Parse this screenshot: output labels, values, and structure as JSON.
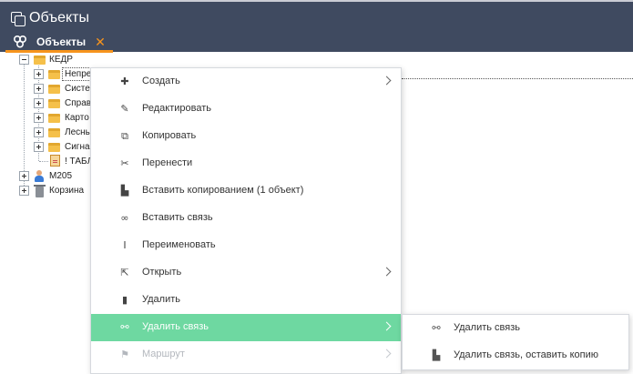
{
  "header": {
    "title": "Объекты",
    "tab_label": "Объекты",
    "tab_close": "✕"
  },
  "tree": {
    "root": "КЕДР",
    "children": [
      {
        "label": "Непре",
        "icon": "folder-icon"
      },
      {
        "label": "Систе",
        "icon": "folder-icon"
      },
      {
        "label": "Справ",
        "icon": "folder-icon"
      },
      {
        "label": "Карто",
        "icon": "folder-icon"
      },
      {
        "label": "Лесны",
        "icon": "folder-icon"
      },
      {
        "label": "Сигна",
        "icon": "folder-icon"
      },
      {
        "label": "! ТАБЛ",
        "icon": "document-icon"
      }
    ],
    "m205": "М205",
    "trash": "Корзина"
  },
  "menu": {
    "items": [
      {
        "label": "Создать",
        "icon": "plus-icon",
        "glyph": "✚",
        "submenu": true
      },
      {
        "label": "Редактировать",
        "icon": "edit-icon",
        "glyph": "✎",
        "submenu": false
      },
      {
        "label": "Копировать",
        "icon": "copy-icon",
        "glyph": "⧉",
        "submenu": false
      },
      {
        "label": "Перенести",
        "icon": "scissors-icon",
        "glyph": "✂",
        "submenu": false
      },
      {
        "label": "Вставить копированием (1 объект)",
        "icon": "paste-icon",
        "glyph": "▙",
        "submenu": false
      },
      {
        "label": "Вставить связь",
        "icon": "link-icon",
        "glyph": "∞",
        "submenu": false
      },
      {
        "label": "Переименовать",
        "icon": "text-cursor-icon",
        "glyph": "I",
        "submenu": false
      },
      {
        "label": "Открыть",
        "icon": "open-external-icon",
        "glyph": "⇱",
        "submenu": true
      },
      {
        "label": "Удалить",
        "icon": "trash-icon",
        "glyph": "▮",
        "submenu": false
      },
      {
        "label": "Удалить связь",
        "icon": "unlink-icon",
        "glyph": "⚯",
        "submenu": true,
        "active": true
      },
      {
        "label": "Маршрут",
        "icon": "route-icon",
        "glyph": "⚑",
        "submenu": true,
        "disabled": true
      }
    ]
  },
  "submenu": {
    "items": [
      {
        "label": "Удалить связь",
        "icon": "unlink-icon",
        "glyph": "⚯"
      },
      {
        "label": "Удалить связь, оставить копию",
        "icon": "paste-icon",
        "glyph": "▙"
      }
    ]
  },
  "colors": {
    "header_bg": "#3f4a60",
    "accent_orange": "#f7941d",
    "menu_active": "#6ed8a1"
  }
}
